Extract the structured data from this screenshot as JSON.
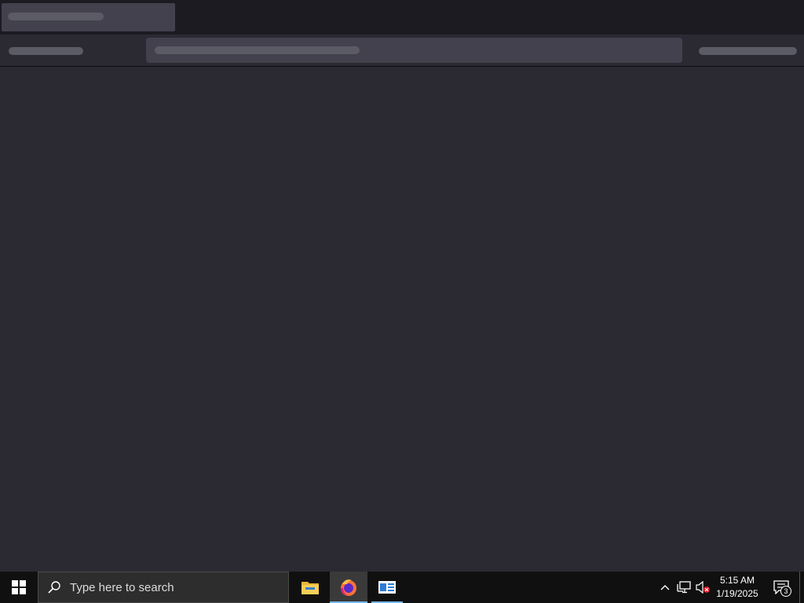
{
  "colors": {
    "tabstrip_bg": "#1c1b22",
    "toolbar_bg": "#2b2a33",
    "skeleton_fill": "#42414d",
    "skeleton_bar": "#5b5b66",
    "taskbar_bg": "#101010",
    "taskbar_accent": "#76b9ed"
  },
  "taskbar": {
    "start_icon": "windows-logo-icon",
    "search": {
      "icon": "search-icon",
      "placeholder": "Type here to search"
    },
    "apps": [
      {
        "name": "File Explorer",
        "icon": "folder-icon",
        "state": "pinned"
      },
      {
        "name": "Firefox",
        "icon": "firefox-icon",
        "state": "active"
      },
      {
        "name": "Window",
        "icon": "window-icon",
        "state": "running"
      }
    ],
    "tray": {
      "chevron_icon": "chevron-up-icon",
      "network_icon": "network-icon",
      "volume_icon": "volume-muted-icon"
    },
    "clock": {
      "time": "5:15 AM",
      "date": "1/19/2025"
    },
    "notifications": {
      "icon": "action-center-icon",
      "count": "3"
    }
  }
}
